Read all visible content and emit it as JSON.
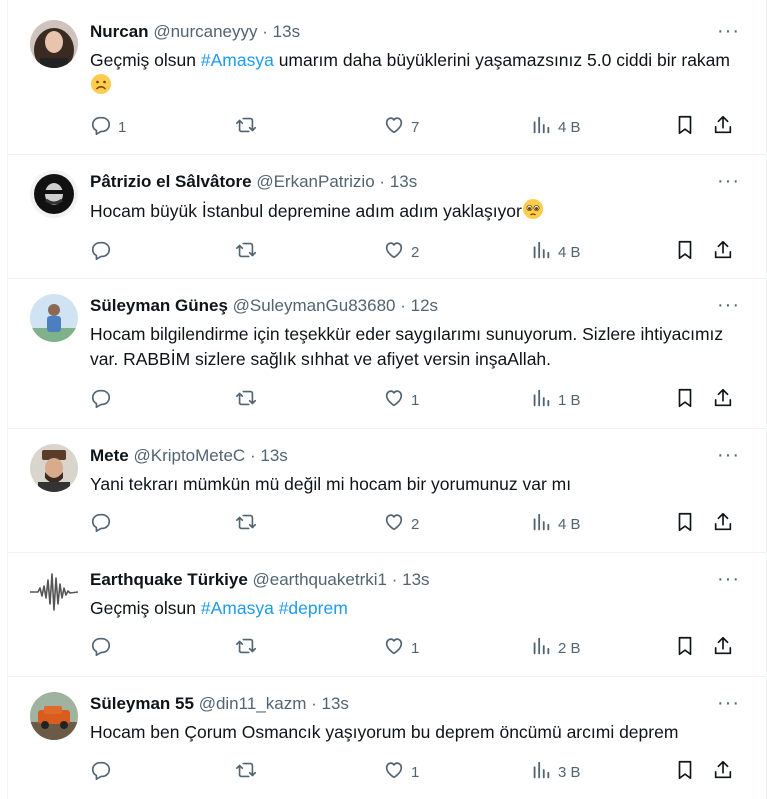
{
  "tweets": [
    {
      "name": "Nurcan",
      "handle": "@nurcaneyyy",
      "time": "13s",
      "body_parts": [
        {
          "text": "Geçmiş olsun "
        },
        {
          "text": "#Amasya",
          "tag": true
        },
        {
          "text": " umarım daha büyüklerini yaşamazsınız 5.0 ciddi bir rakam"
        }
      ],
      "emoji": "frowning-face",
      "replies": "1",
      "retweets": "",
      "likes": "7",
      "views": "4 B"
    },
    {
      "name": "Pâtrizio el Sâlvâtore",
      "handle": "@ErkanPatrizio",
      "time": "13s",
      "body_parts": [
        {
          "text": "Hocam büyük İstanbul depremine adım adım yaklaşıyor"
        }
      ],
      "emoji": "pleading-face",
      "replies": "",
      "retweets": "",
      "likes": "2",
      "views": "4 B"
    },
    {
      "name": "Süleyman Güneş",
      "handle": "@SuleymanGu83680",
      "time": "12s",
      "body_parts": [
        {
          "text": "Hocam bilgilendirme için teşekkür eder saygılarımı sunuyorum. Sizlere ihtiyacımız var. RABBİM sizlere sağlık sıhhat ve afiyet versin inşaAllah."
        }
      ],
      "emoji": "",
      "replies": "",
      "retweets": "",
      "likes": "1",
      "views": "1 B"
    },
    {
      "name": "Mete",
      "handle": "@KriptoMeteC",
      "time": "13s",
      "body_parts": [
        {
          "text": "Yani tekrarı mümkün mü değil mi hocam bir yorumunuz var mı"
        }
      ],
      "emoji": "",
      "replies": "",
      "retweets": "",
      "likes": "2",
      "views": "4 B"
    },
    {
      "name": "Earthquake Türkiye",
      "handle": "@earthquaketrki1",
      "time": "13s",
      "body_parts": [
        {
          "text": "Geçmiş olsun "
        },
        {
          "text": "#Amasya",
          "tag": true
        },
        {
          "text": " "
        },
        {
          "text": "#deprem",
          "tag": true
        }
      ],
      "emoji": "",
      "replies": "",
      "retweets": "",
      "likes": "1",
      "views": "2 B"
    },
    {
      "name": "Süleyman 55",
      "handle": "@din11_kazm",
      "time": "13s",
      "body_parts": [
        {
          "text": "Hocam ben Çorum Osmancık yaşıyorum bu deprem öncümü arcımi deprem"
        }
      ],
      "emoji": "",
      "replies": "",
      "retweets": "",
      "likes": "1",
      "views": "3 B"
    }
  ],
  "separator": "·",
  "more_label": "···",
  "colors": {
    "link": "#1d9bf0",
    "secondary_text": "#536471",
    "divider": "#eff3f4"
  },
  "icons": [
    "reply-icon",
    "retweet-icon",
    "like-icon",
    "views-icon",
    "bookmark-icon",
    "share-icon",
    "more-icon"
  ]
}
